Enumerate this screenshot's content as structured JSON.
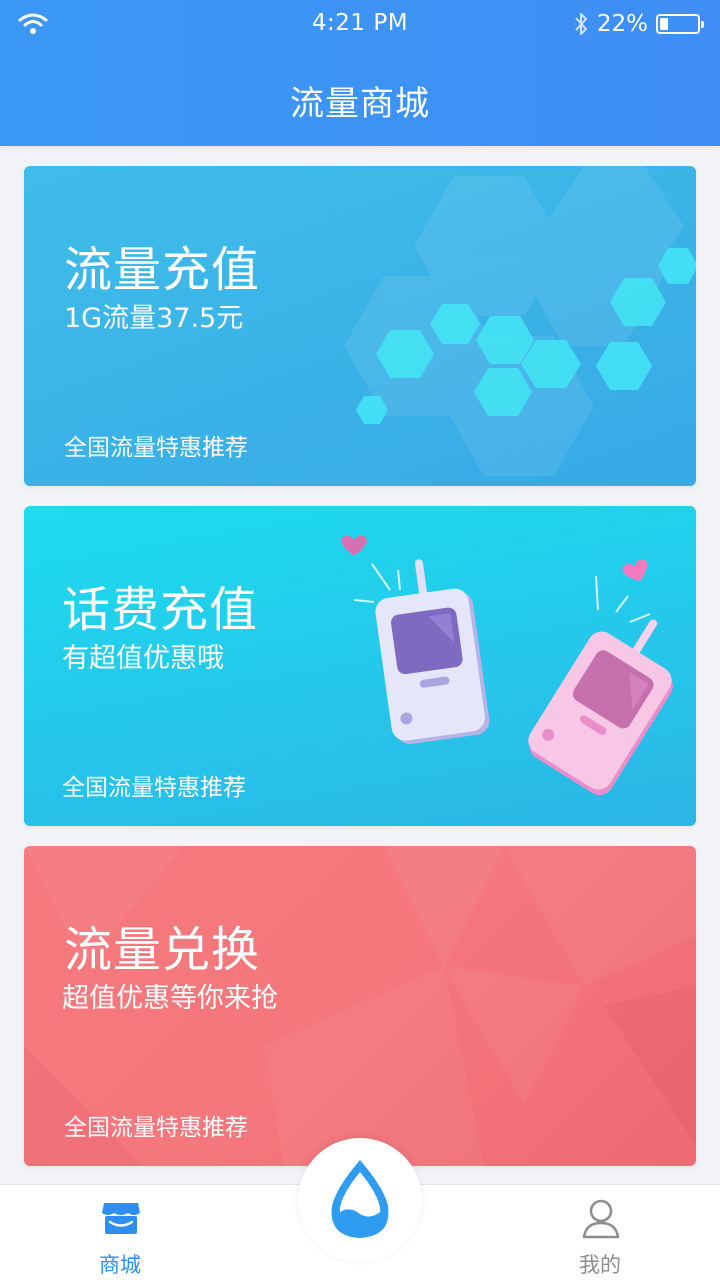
{
  "status_bar": {
    "time": "4:21 PM",
    "battery_percent": "22%",
    "battery_level": 0.22
  },
  "header": {
    "title": "流量商城"
  },
  "cards": [
    {
      "title": "流量充值",
      "subtitle": "1G流量37.5元",
      "footer": "全国流量特惠推荐",
      "theme_color": "#3fb4e8"
    },
    {
      "title": "话费充值",
      "subtitle": "有超值优惠哦",
      "footer": "全国流量特惠推荐",
      "theme_color": "#22cdec"
    },
    {
      "title": "流量兑换",
      "subtitle": "超值优惠等你来抢",
      "footer": "全国流量特惠推荐",
      "theme_color": "#f4777c"
    }
  ],
  "tabbar": {
    "items": [
      {
        "label": "商城",
        "icon": "store-icon",
        "active": true
      },
      {
        "label": "我的",
        "icon": "person-icon",
        "active": false
      }
    ],
    "center_icon": "water-drop-icon",
    "active_color": "#2f8ff0"
  }
}
